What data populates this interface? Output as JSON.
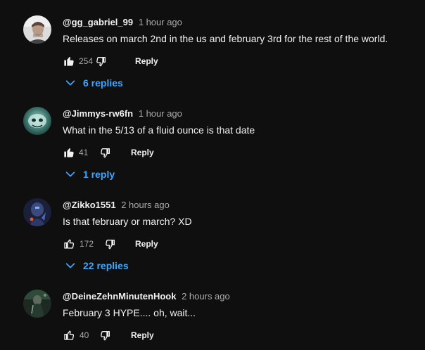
{
  "colors": {
    "background": "#0f0f0f",
    "primary_text": "#f1f1f1",
    "secondary_text": "#aaaaaa",
    "link_blue": "#3ea6ff"
  },
  "comments": [
    {
      "author": "@gg_gabriel_99",
      "time": "1 hour ago",
      "text": "Releases on march 2nd in the us and february 3rd for the rest of the world.",
      "likes": "254",
      "liked": true,
      "reply_label": "Reply",
      "replies": "6 replies",
      "avatar_icon": "avatar-photo"
    },
    {
      "author": "@Jimmys-rw6fn",
      "time": "1 hour ago",
      "text": "What in the 5/13 of a fluid ounce is that date",
      "likes": "41",
      "liked": true,
      "reply_label": "Reply",
      "replies": "1 reply",
      "avatar_icon": "avatar-photo"
    },
    {
      "author": "@Zikko1551",
      "time": "2 hours ago",
      "text": "Is that february or march? XD",
      "likes": "172",
      "liked": false,
      "reply_label": "Reply",
      "replies": "22 replies",
      "avatar_icon": "avatar-photo"
    },
    {
      "author": "@DeineZehnMinutenHook",
      "time": "2 hours ago",
      "text": "February 3 HYPE.... oh, wait...",
      "likes": "40",
      "liked": false,
      "reply_label": "Reply",
      "replies": "",
      "avatar_icon": "avatar-photo"
    }
  ],
  "icons": {
    "like": "thumbs-up-icon",
    "dislike": "thumbs-down-icon",
    "expand": "chevron-down-icon"
  }
}
